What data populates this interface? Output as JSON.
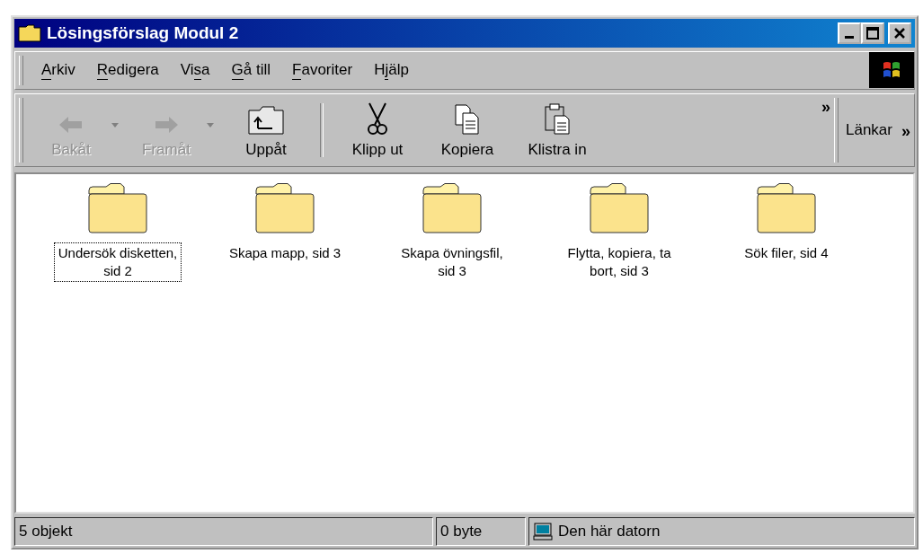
{
  "window": {
    "title": "Lösingsförslag Modul 2"
  },
  "menu": [
    {
      "parts": [
        {
          "text": "A",
          "underlined": true
        },
        {
          "text": "rkiv",
          "underlined": false
        }
      ]
    },
    {
      "parts": [
        {
          "text": "R",
          "underlined": true
        },
        {
          "text": "edigera",
          "underlined": false
        }
      ]
    },
    {
      "parts": [
        {
          "text": "Vi",
          "underlined": false
        },
        {
          "text": "s",
          "underlined": true
        },
        {
          "text": "a",
          "underlined": false
        }
      ]
    },
    {
      "parts": [
        {
          "text": "G",
          "underlined": true
        },
        {
          "text": "å till",
          "underlined": false
        }
      ]
    },
    {
      "parts": [
        {
          "text": "F",
          "underlined": true
        },
        {
          "text": "avoriter",
          "underlined": false
        }
      ]
    },
    {
      "parts": [
        {
          "text": "H",
          "underlined": false
        },
        {
          "text": "j",
          "underlined": true
        },
        {
          "text": "älp",
          "underlined": false
        }
      ]
    }
  ],
  "toolbar": [
    {
      "kind": "back",
      "label": "Bakåt",
      "disabled": true,
      "dropdown": true
    },
    {
      "kind": "forward",
      "label": "Framåt",
      "disabled": true,
      "dropdown": true
    },
    {
      "kind": "up",
      "label": "Uppåt",
      "disabled": false,
      "dropdown": false
    },
    {
      "kind": "cut",
      "label": "Klipp ut",
      "disabled": false,
      "dropdown": false
    },
    {
      "kind": "copy",
      "label": "Kopiera",
      "disabled": false,
      "dropdown": false
    },
    {
      "kind": "paste",
      "label": "Klistra in",
      "disabled": false,
      "dropdown": false
    }
  ],
  "links": {
    "label": "Länkar",
    "chevron": "»"
  },
  "toolbar_chevron": "»",
  "folders": [
    {
      "name": "Undersök disketten, sid 2",
      "selected": true
    },
    {
      "name": "Skapa mapp, sid 3",
      "selected": false
    },
    {
      "name": "Skapa övningsfil, sid 3",
      "selected": false
    },
    {
      "name": "Flytta, kopiera, ta bort, sid 3",
      "selected": false
    },
    {
      "name": "Sök filer, sid 4",
      "selected": false
    }
  ],
  "status_bar": {
    "count": "5 objekt",
    "size": "0 byte",
    "location": "Den här datorn"
  }
}
